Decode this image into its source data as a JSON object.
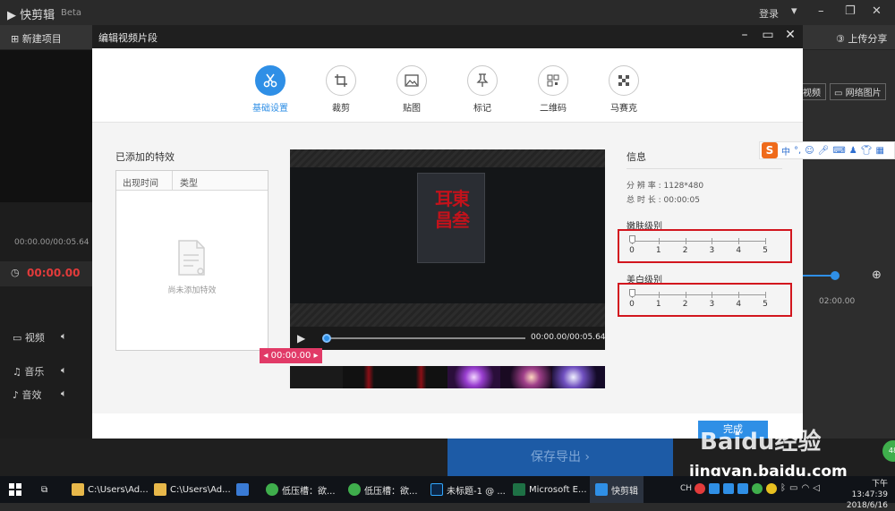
{
  "app": {
    "name": "快剪辑",
    "badge": "Beta",
    "login": "登录",
    "toolbar": {
      "new_project": "新建项目",
      "upload_share": "上传分享",
      "video_btn": "视频",
      "web_image_btn": "网络图片"
    },
    "timecode_top": "00:00.00/00:05.64",
    "playhead_time": "00:00.00",
    "ruler_label": "02:00.00",
    "tracks": {
      "video": "视频",
      "music": "音乐",
      "sfx": "音效"
    },
    "save_export": "保存导出"
  },
  "dialog": {
    "title": "编辑视频片段",
    "tabs": [
      {
        "label": "基础设置",
        "icon": "scissors-icon"
      },
      {
        "label": "裁剪",
        "icon": "crop-icon"
      },
      {
        "label": "贴图",
        "icon": "image-icon"
      },
      {
        "label": "标记",
        "icon": "pin-icon"
      },
      {
        "label": "二维码",
        "icon": "qrcode-icon"
      },
      {
        "label": "马赛克",
        "icon": "mosaic-icon"
      }
    ],
    "effects": {
      "title": "已添加的特效",
      "col_time": "出现时间",
      "col_type": "类型",
      "empty": "尚未添加特效"
    },
    "player": {
      "time": "00:00.00/00:05.64",
      "marker": "00:00.00",
      "progress": 0
    },
    "info": {
      "title": "信息",
      "resolution_label": "分 辨 率 :",
      "resolution": "1128*480",
      "duration_label": "总 时 长 :",
      "duration": "00:00:05"
    },
    "sliders": {
      "smooth": {
        "label": "嫩肤级别",
        "value": 0,
        "ticks": [
          "0",
          "1",
          "2",
          "3",
          "4",
          "5"
        ]
      },
      "whiten": {
        "label": "美白级别",
        "value": 0,
        "ticks": [
          "0",
          "1",
          "2",
          "3",
          "4",
          "5"
        ]
      }
    },
    "done_button": "完成"
  },
  "ime": {
    "lang": "中"
  },
  "taskbar": {
    "items": [
      {
        "label": "C:\\Users\\Ad..."
      },
      {
        "label": "C:\\Users\\Ad..."
      },
      {
        "label": ""
      },
      {
        "label": "低压槽：欲..."
      },
      {
        "label": "低压槽：欲..."
      },
      {
        "label": "未标题-1 @ ..."
      },
      {
        "label": "Microsoft E..."
      },
      {
        "label": "快剪辑"
      }
    ],
    "ime_tray": "CH",
    "clock_time": "下午 13:47:39",
    "clock_date": "2018/6/16"
  },
  "watermark": {
    "brand": "Baidu经验",
    "url": "jingyan.baidu.com"
  },
  "badge": "48"
}
